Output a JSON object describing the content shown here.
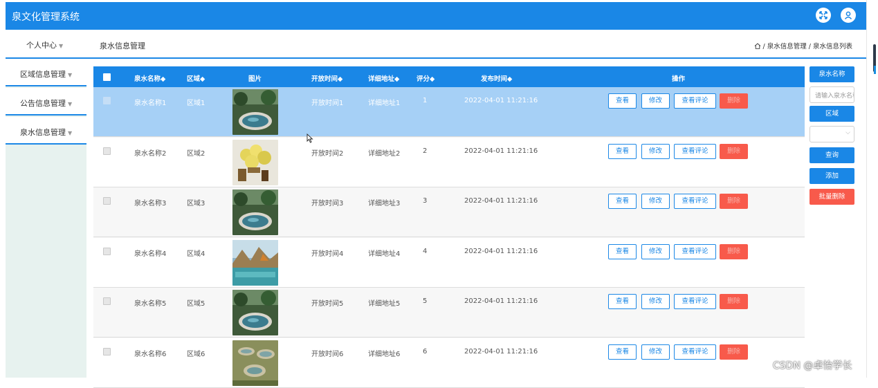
{
  "app": {
    "title": "泉文化管理系统"
  },
  "header_icons": [
    "expand-icon",
    "user-icon"
  ],
  "navbar": {
    "personal_center": "个人中心",
    "page_title": "泉水信息管理",
    "breadcrumb": "/ 泉水信息管理 / 泉水信息列表"
  },
  "sidebar": {
    "items": [
      {
        "label": "区域信息管理"
      },
      {
        "label": "公告信息管理"
      },
      {
        "label": "泉水信息管理"
      }
    ]
  },
  "table": {
    "headers": {
      "name": "泉水名称◆",
      "region": "区域◆",
      "image": "图片",
      "open_time": "开放时间◆",
      "address": "详细地址◆",
      "score": "评分◆",
      "publish_time": "发布时间◆",
      "actions": "操作"
    },
    "rows": [
      {
        "name": "泉水名称1",
        "region": "区域1",
        "open_time": "开放时间1",
        "address": "详细地址1",
        "score": "1",
        "publish_time": "2022-04-01 11:21:16",
        "image": "pond"
      },
      {
        "name": "泉水名称2",
        "region": "区域2",
        "open_time": "开放时间2",
        "address": "详细地址2",
        "score": "2",
        "publish_time": "2022-04-01 11:21:16",
        "image": "flowers"
      },
      {
        "name": "泉水名称3",
        "region": "区域3",
        "open_time": "开放时间3",
        "address": "详细地址3",
        "score": "3",
        "publish_time": "2022-04-01 11:21:16",
        "image": "pond"
      },
      {
        "name": "泉水名称4",
        "region": "区域4",
        "open_time": "开放时间4",
        "address": "详细地址4",
        "score": "4",
        "publish_time": "2022-04-01 11:21:16",
        "image": "lake"
      },
      {
        "name": "泉水名称5",
        "region": "区域5",
        "open_time": "开放时间5",
        "address": "详细地址5",
        "score": "5",
        "publish_time": "2022-04-01 11:21:16",
        "image": "pond"
      },
      {
        "name": "泉水名称6",
        "region": "区域6",
        "open_time": "开放时间6",
        "address": "详细地址6",
        "score": "6",
        "publish_time": "2022-04-01 11:21:16",
        "image": "ponds"
      }
    ],
    "row_buttons": {
      "view": "查看",
      "edit": "修改",
      "view_comments": "查看评论",
      "delete": "删除"
    }
  },
  "search_panel": {
    "name_label": "泉水名称",
    "name_placeholder": "请输入泉水名称",
    "region_label": "区域",
    "region_value": "",
    "query": "查询",
    "add": "添加",
    "batch_delete": "批量删除"
  },
  "watermark": "CSDN @卓怡学长",
  "colors": {
    "primary": "#1a87e6",
    "selected_row": "#a6d0f6",
    "danger": "#f85a4b",
    "sidebar_bg": "#e7f2ef"
  }
}
